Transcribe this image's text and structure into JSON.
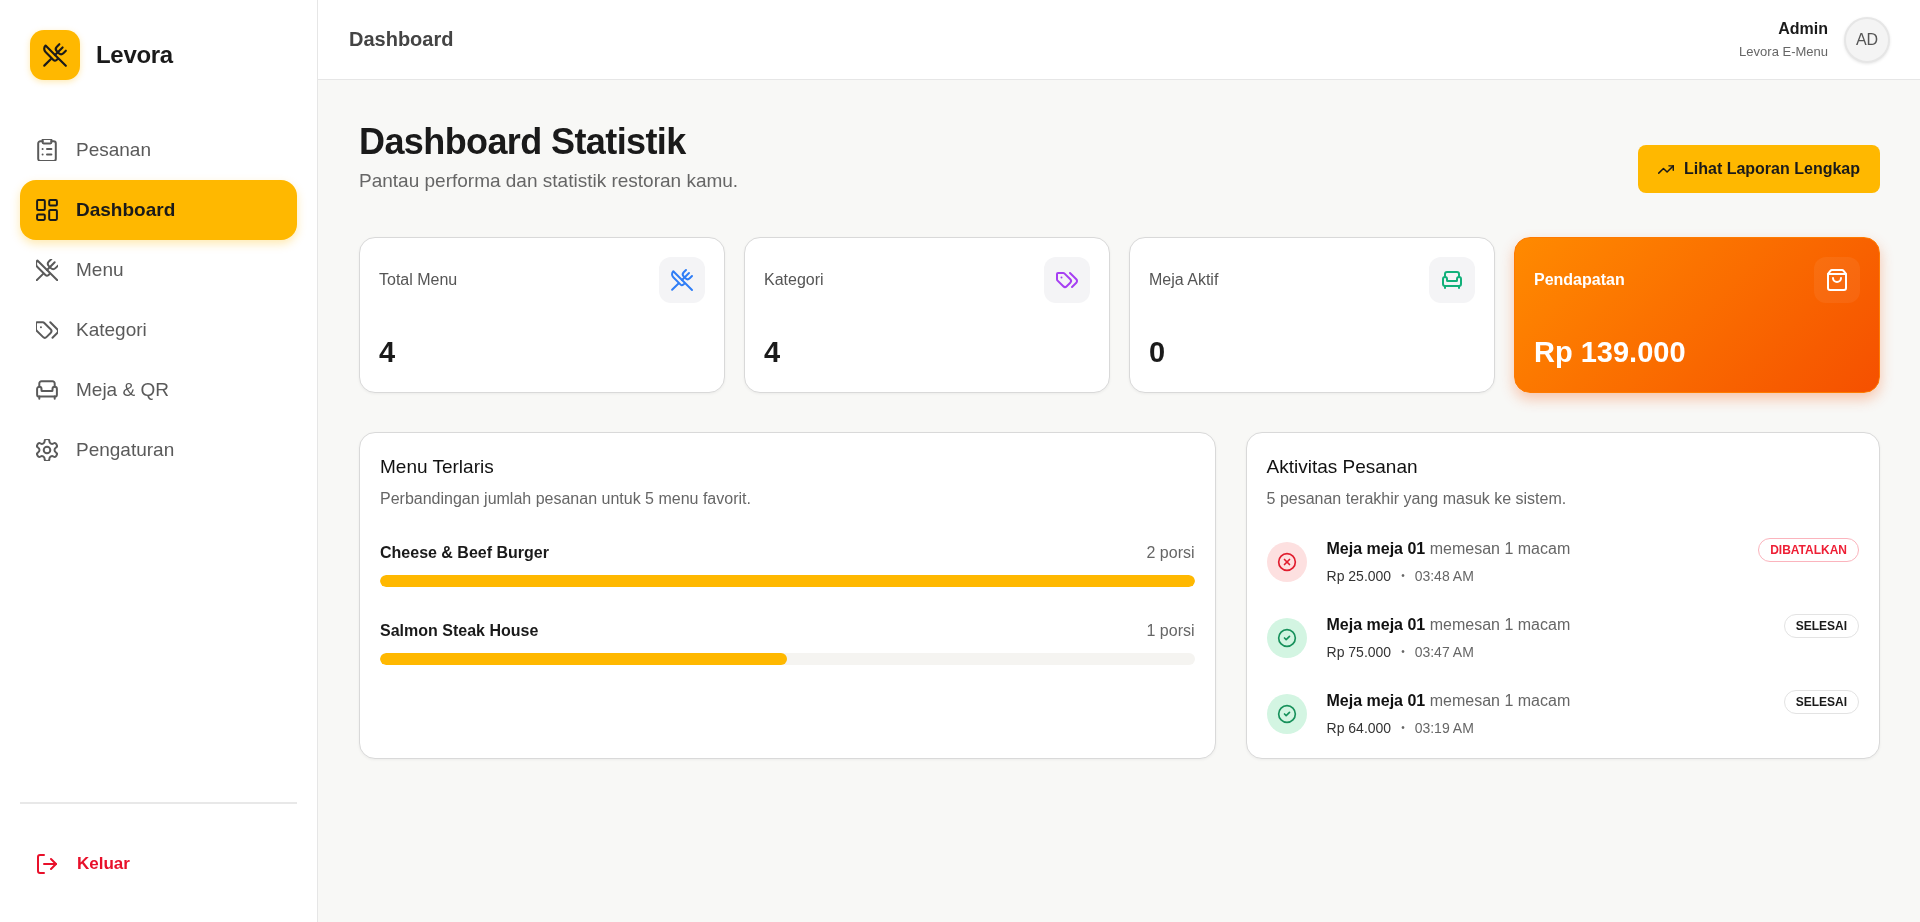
{
  "sidebar": {
    "brand": "Levora",
    "items": [
      {
        "label": "Pesanan",
        "selected": false
      },
      {
        "label": "Dashboard",
        "selected": true
      },
      {
        "label": "Menu",
        "selected": false
      },
      {
        "label": "Kategori",
        "selected": false
      },
      {
        "label": "Meja & QR",
        "selected": false
      },
      {
        "label": "Pengaturan",
        "selected": false
      }
    ],
    "logout": "Keluar"
  },
  "header": {
    "title": "Dashboard",
    "user": {
      "name": "Admin",
      "role": "Levora E-Menu",
      "initials": "AD"
    }
  },
  "page": {
    "title": "Dashboard Statistik",
    "subtitle": "Pantau performa dan statistik restoran kamu.",
    "action": "Lihat Laporan Lengkap"
  },
  "stats": [
    {
      "kind": "plain",
      "label": "Total Menu",
      "value": "4"
    },
    {
      "kind": "plain",
      "label": "Kategori",
      "value": "4"
    },
    {
      "kind": "plain",
      "label": "Meja Aktif",
      "value": "0"
    },
    {
      "kind": "highlight",
      "label": "Pendapatan",
      "value": "Rp 139.000"
    }
  ],
  "top_menu": {
    "title": "Menu Terlaris",
    "subtitle": "Perbandingan jumlah pesanan untuk 5 menu favorit.",
    "items": [
      {
        "name": "Cheese & Beef Burger",
        "count": "2 porsi",
        "level": 1
      },
      {
        "name": "Salmon Steak House",
        "count": "1 porsi",
        "level": 0.5
      }
    ]
  },
  "activity": {
    "title": "Aktivitas Pesanan",
    "subtitle": "5 pesanan terakhir yang masuk ke sistem.",
    "items": [
      {
        "kind": "cancelled",
        "summary": "**Meja meja 01** memesan 1 macam",
        "amount": "Rp 25.000",
        "separator": "•",
        "time": "03:48 AM",
        "status": "DIBATALKAN"
      },
      {
        "kind": "completed",
        "summary": "**Meja meja 01** memesan 1 macam",
        "amount": "Rp 75.000",
        "separator": "•",
        "time": "03:47 AM",
        "status": "SELESAI"
      },
      {
        "kind": "completed",
        "summary": "**Meja meja 01** memesan 1 macam",
        "amount": "Rp 64.000",
        "separator": "•",
        "time": "03:19 AM",
        "status": "SELESAI"
      }
    ]
  }
}
